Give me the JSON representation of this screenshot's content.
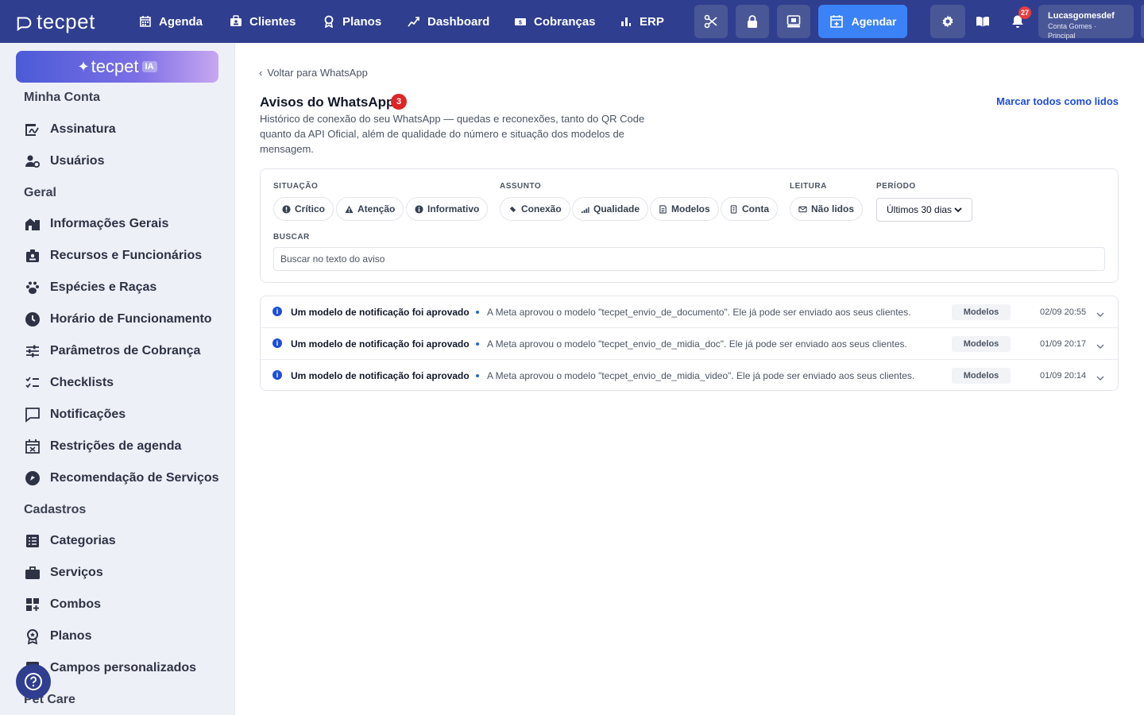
{
  "topbar": {
    "logo_text": "tecpet",
    "nav": [
      {
        "label": "Agenda",
        "icon": "calendar-icon"
      },
      {
        "label": "Clientes",
        "icon": "clients-icon"
      },
      {
        "label": "Planos",
        "icon": "award-icon"
      },
      {
        "label": "Dashboard",
        "icon": "chart-line-icon"
      },
      {
        "label": "Cobranças",
        "icon": "money-icon"
      },
      {
        "label": "ERP",
        "icon": "bar-chart-icon"
      }
    ],
    "agendar_label": "Agendar",
    "notification_count": "27",
    "user_name": "Lucasgomesdef",
    "user_sub": "Conta Gomes · Principal",
    "colors": {
      "bar": "#2f3e8f",
      "button": "#4a5796",
      "primary": "#3b82f6",
      "badge": "#e53e3e"
    }
  },
  "sidebar": {
    "ia_brand": "tecpet",
    "ia_tag": "IA",
    "sections": [
      {
        "title": "Minha Conta",
        "items": [
          {
            "label": "Assinatura",
            "icon": "signature-icon"
          },
          {
            "label": "Usuários",
            "icon": "users-gear-icon"
          }
        ]
      },
      {
        "title": "Geral",
        "items": [
          {
            "label": "Informações Gerais",
            "icon": "building-icon"
          },
          {
            "label": "Recursos e Funcionários",
            "icon": "id-badge-icon"
          },
          {
            "label": "Espécies e Raças",
            "icon": "paw-icon"
          },
          {
            "label": "Horário de Funcionamento",
            "icon": "clock-icon"
          },
          {
            "label": "Parâmetros de Cobrança",
            "icon": "sliders-icon"
          },
          {
            "label": "Checklists",
            "icon": "checklist-icon"
          },
          {
            "label": "Notificações",
            "icon": "message-icon"
          },
          {
            "label": "Restrições de agenda",
            "icon": "calendar-x-icon"
          },
          {
            "label": "Recomendação de Serviços",
            "icon": "recommend-icon"
          }
        ]
      },
      {
        "title": "Cadastros",
        "items": [
          {
            "label": "Categorias",
            "icon": "list-icon"
          },
          {
            "label": "Serviços",
            "icon": "briefcase-icon"
          },
          {
            "label": "Combos",
            "icon": "grid-plus-icon"
          },
          {
            "label": "Planos",
            "icon": "award-icon"
          },
          {
            "label": "Campos personalizados",
            "icon": "fields-icon"
          }
        ]
      },
      {
        "title": "Pet Care",
        "items": []
      }
    ]
  },
  "main": {
    "back_label": "Voltar para WhatsApp",
    "title": "Avisos do WhatsApp",
    "title_count": "3",
    "description": "Histórico de conexão do seu WhatsApp — quedas e reconexões, tanto do QR Code quanto da API Oficial, além de qualidade do número e situação dos modelos de mensagem.",
    "mark_all_read": "Marcar todos como lidos",
    "filters": {
      "situacao_label": "SITUAÇÃO",
      "situacao_chips": [
        "Crítico",
        "Atenção",
        "Informativo"
      ],
      "assunto_label": "ASSUNTO",
      "assunto_chips": [
        "Conexão",
        "Qualidade",
        "Modelos",
        "Conta"
      ],
      "leitura_label": "LEITURA",
      "leitura_chip": "Não lidos",
      "periodo_label": "PERÍODO",
      "periodo_value": "Últimos 30 dias",
      "buscar_label": "BUSCAR",
      "search_placeholder": "Buscar no texto do aviso"
    },
    "alerts": [
      {
        "title": "Um modelo de notificação foi aprovado",
        "message": "A Meta aprovou o modelo \"tecpet_envio_de_documento\". Ele já pode ser enviado aos seus clientes.",
        "tag": "Modelos",
        "date": "02/09 20:55"
      },
      {
        "title": "Um modelo de notificação foi aprovado",
        "message": "A Meta aprovou o modelo \"tecpet_envio_de_midia_doc\". Ele já pode ser enviado aos seus clientes.",
        "tag": "Modelos",
        "date": "01/09 20:17"
      },
      {
        "title": "Um modelo de notificação foi aprovado",
        "message": "A Meta aprovou o modelo \"tecpet_envio_de_midia_video\". Ele já pode ser enviado aos seus clientes.",
        "tag": "Modelos",
        "date": "01/09 20:14"
      }
    ]
  }
}
